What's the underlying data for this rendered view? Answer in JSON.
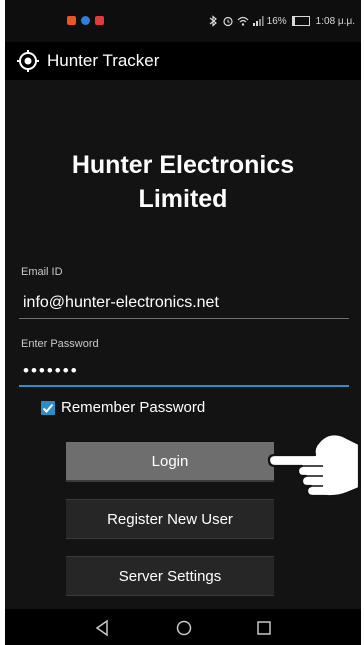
{
  "status_bar": {
    "notification_icons": [
      "photos-icon",
      "messenger-icon",
      "mail-icon"
    ],
    "notification_colors": [
      "#e8572a",
      "#2f7de1",
      "#e33b3b"
    ],
    "system_icons": [
      "bluetooth-icon",
      "alarm-icon",
      "wifi-icon",
      "signal-icon"
    ],
    "battery_percent": "16%",
    "battery_level": 0.16,
    "time": "1:08 μ.μ."
  },
  "app_bar": {
    "icon": "crosshair-target-icon",
    "title": "Hunter Tracker"
  },
  "main": {
    "company_name_line1": "Hunter Electronics",
    "company_name_line2": "Limited",
    "email_label": "Email ID",
    "email_value": "info@hunter-electronics.net",
    "password_label": "Enter Password",
    "password_value": "•••••••",
    "remember_label": "Remember Password",
    "remember_checked": true,
    "login_label": "Login",
    "register_label": "Register New User",
    "server_label": "Server Settings"
  },
  "nav_bar": {
    "back": "back-triangle-icon",
    "home": "home-circle-icon",
    "recents": "recents-square-icon"
  },
  "colors": {
    "accent": "#2a8ec7",
    "background": "#131313",
    "login_button": "#6e6e6e"
  }
}
